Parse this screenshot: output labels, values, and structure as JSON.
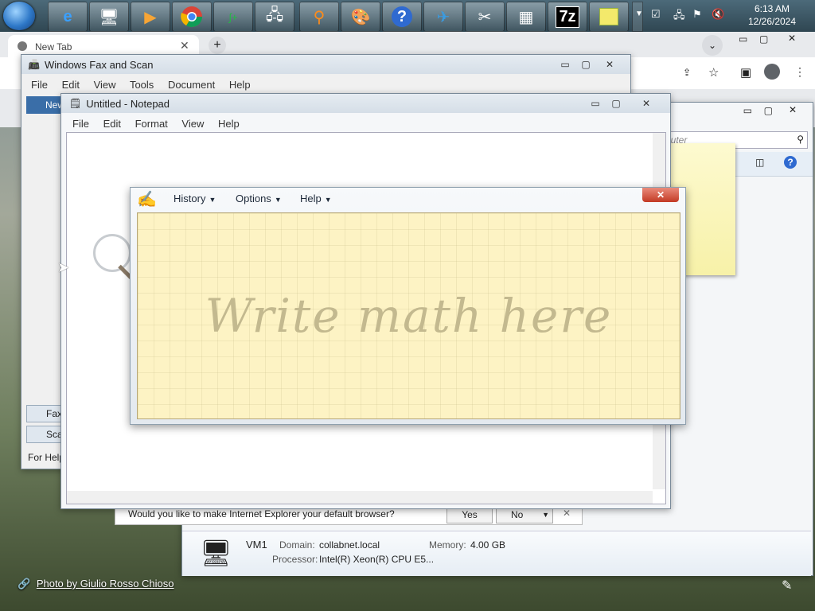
{
  "taskbar": {
    "apps": [
      "ie-icon",
      "computer-icon",
      "media-icon",
      "chrome-icon",
      "calculator-app-icon",
      "network-icon",
      "magnifier-icon",
      "paint-icon",
      "help-icon",
      "mail-icon",
      "snipping-icon",
      "calc-icon",
      "7zip-icon",
      "sticky-notes-icon"
    ],
    "sevenzip_label": "7z",
    "clock_time": "6:13 AM",
    "clock_date": "12/26/2024"
  },
  "chrome": {
    "tab_title": "New Tab"
  },
  "fax": {
    "title": "Windows Fax and Scan",
    "menu": [
      "File",
      "Edit",
      "View",
      "Tools",
      "Document",
      "Help"
    ],
    "tab_label": "New",
    "side_fax": "Fax",
    "side_scan": "Sca",
    "status": "For Help"
  },
  "notepad": {
    "title": "Untitled - Notepad",
    "menu": [
      "File",
      "Edit",
      "Format",
      "View",
      "Help"
    ]
  },
  "math": {
    "menu_history": "History",
    "menu_options": "Options",
    "menu_help": "Help",
    "placeholder": "Write math here"
  },
  "explorer": {
    "search_placeholder": "puter",
    "computer_name": "VM1",
    "domain_label": "Domain:",
    "domain_value": "collabnet.local",
    "memory_label": "Memory:",
    "memory_value": "4.00 GB",
    "processor_label": "Processor:",
    "processor_value": "Intel(R) Xeon(R) CPU E5..."
  },
  "ie_bar": {
    "question": "Would you like to make Internet Explorer your default browser?",
    "yes": "Yes",
    "no": "No"
  },
  "wallpaper": {
    "credit": "Photo by Giulio Rosso Chioso"
  }
}
